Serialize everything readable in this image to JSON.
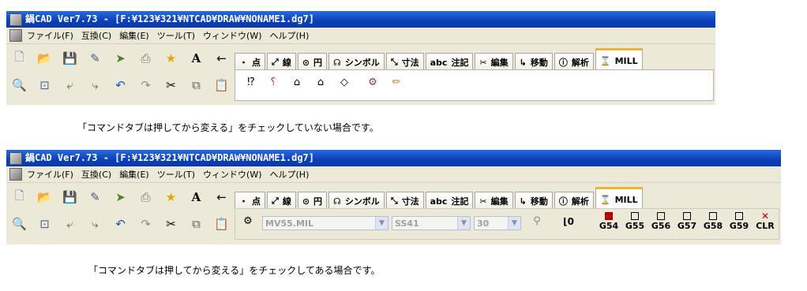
{
  "window_title": "鍋CAD Ver7.73 - [F:¥123¥321¥NTCAD¥DRAW¥NONAME1.dg7]",
  "menu": [
    "ファイル(F)",
    "互換(C)",
    "編集(E)",
    "ツール(T)",
    "ウィンドウ(W)",
    "ヘルプ(H)"
  ],
  "toolbar_row1_icons": [
    "new-icon",
    "open-icon",
    "save-icon",
    "edit-icon",
    "run-icon",
    "print-icon",
    "star-icon",
    "text-icon",
    "arrow-left-icon"
  ],
  "toolbar_row2_icons": [
    "zoom-icon",
    "zoom-area-icon",
    "zoom-prev-icon",
    "zoom-next-icon",
    "undo-icon",
    "redo-icon",
    "cut-icon",
    "copy-icon",
    "paste-icon"
  ],
  "tabs": [
    {
      "icon": "・",
      "label": "点"
    },
    {
      "icon": "⤢",
      "label": "線"
    },
    {
      "icon": "⊙",
      "label": "円"
    },
    {
      "icon": "☊",
      "label": "シンボル"
    },
    {
      "icon": "⤡",
      "label": "寸法"
    },
    {
      "icon": "abc",
      "label": "注記"
    },
    {
      "icon": "✂",
      "label": "編集"
    },
    {
      "icon": "↳",
      "label": "移動"
    },
    {
      "icon": "ⓘ",
      "label": "解析"
    },
    {
      "icon": "⌛",
      "label": "MILL"
    }
  ],
  "caption1": "「コマンドタブは押してから変える」をチェックしていない場合です。",
  "caption2": "「コマンドタブは押してから変える」をチェックしてある場合です。",
  "mill": {
    "machine": "MV55.MIL",
    "material": "SS41",
    "value": "30",
    "offset_value": "0",
    "g_codes": [
      "G54",
      "G55",
      "G56",
      "G57",
      "G58",
      "G59",
      "CLR"
    ],
    "active_g": "G54"
  }
}
